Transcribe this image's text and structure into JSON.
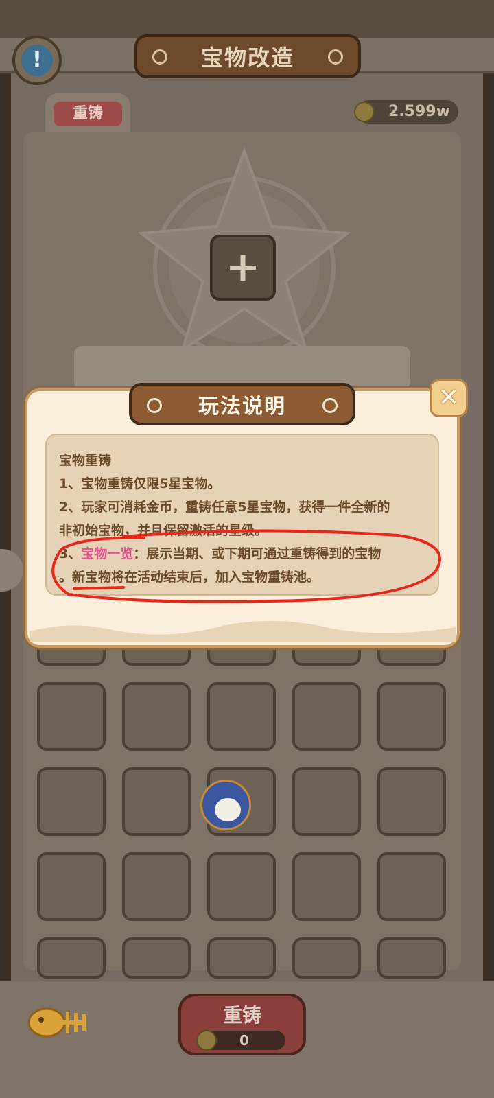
{
  "header": {
    "title": "宝物改造",
    "info_icon": "exclamation-icon"
  },
  "tabs": [
    {
      "label": "重铸",
      "active": true
    }
  ],
  "currency": {
    "amount": "2.599w",
    "icon": "gold-coin-icon"
  },
  "slot": {
    "add_icon": "plus-icon"
  },
  "bottom": {
    "recast_label": "重铸",
    "cost": "0",
    "pet_icon": "fish-bone-icon"
  },
  "modal": {
    "title": "玩法说明",
    "close_icon": "close-icon",
    "heading": "宝物重铸",
    "line1": "1、宝物重铸仅限5星宝物。",
    "line2a": "2、玩家可消耗金币，重铸任意5星宝物，获得一件全新的",
    "line2b": "非初始宝物，并且保留激活的星级。",
    "line3_prefix": "3、",
    "line3_link": "宝物一览",
    "line3_rest": "：展示当期、或下期可通过重铸得到的宝物",
    "line3b": "。新宝物将在活动结束后，加入宝物重铸池。"
  },
  "colors": {
    "accent_pink": "#e6508e",
    "annotation_red": "#e8261c",
    "modal_bg": "#fbeedb"
  }
}
